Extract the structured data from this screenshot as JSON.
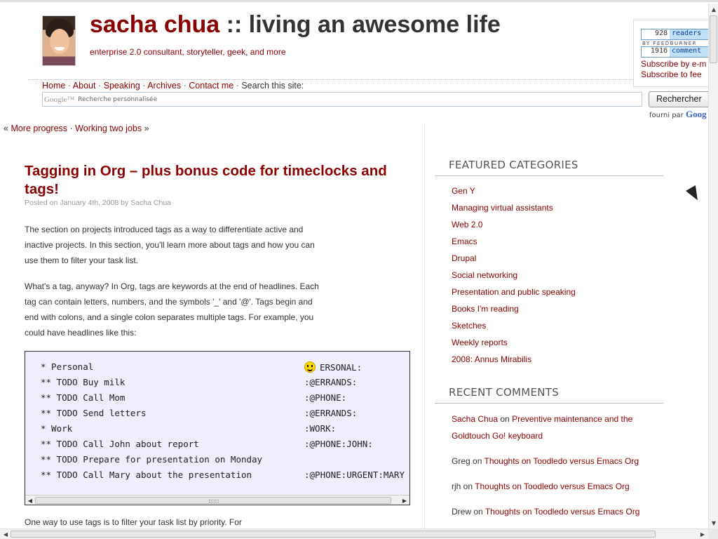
{
  "header": {
    "title_name": "sacha chua",
    "title_rest": " :: living an awesome life",
    "tagline": "enterprise 2.0 consultant, storyteller, geek, and more"
  },
  "feedburner": {
    "readers_count": "928",
    "readers_label": "readers",
    "by_label": "BY FEEDBURNER",
    "comments_count": "1916",
    "comments_label": "comment",
    "subscribe_email": "Subscribe by e-m",
    "subscribe_feed": "Subscribe to fee"
  },
  "nav": {
    "items": [
      "Home",
      "About",
      "Speaking",
      "Archives",
      "Contact me"
    ],
    "search_label": "Search this site:",
    "separator": "·"
  },
  "search": {
    "google_logo": "Google™",
    "placeholder": "Recherche personnalisée",
    "button": "Rechercher",
    "powered_by": "fourni par",
    "powered_logo": "Goog"
  },
  "post_nav": {
    "prev_marker": "«",
    "prev": "More progress",
    "sep": "·",
    "next": "Working two jobs",
    "next_marker": "»"
  },
  "post": {
    "title": "Tagging in Org – plus bonus code for timeclocks and tags!",
    "meta_prefix": "Posted on ",
    "date": "January 4th, 2008",
    "meta_by": " by ",
    "author": "Sacha Chua",
    "para1": "The section on projects introduced tags as a way to differentiate active and inactive projects. In this section, you'll learn more about tags and how you can use them to filter your task list.",
    "para2": "What's a tag, anyway? In Org, tags are keywords at the end of headlines. Each tag can contain letters, numbers, and the symbols '_' and '@'. Tags begin and end with colons, and a single colon separates multiple tags. For example, you could have headlines like this:",
    "para3": "One way to use tags is to filter your task list by priority. For",
    "code": [
      {
        "text": "* Personal",
        "tags": "ERSONAL:"
      },
      {
        "text": "** TODO Buy milk",
        "tags": ":@ERRANDS:"
      },
      {
        "text": "** TODO Call Mom",
        "tags": ":@PHONE:"
      },
      {
        "text": "** TODO Send letters",
        "tags": ":@ERRANDS:"
      },
      {
        "text": "* Work",
        "tags": ":WORK:"
      },
      {
        "text": "** TODO Call John about report",
        "tags": ":@PHONE:JOHN:"
      },
      {
        "text": "** TODO Prepare for presentation on Monday",
        "tags": ""
      },
      {
        "text": "** TODO Call Mary about the presentation",
        "tags": ":@PHONE:URGENT:MARY"
      }
    ]
  },
  "sidebar": {
    "categories_title": "FEATURED CATEGORIES",
    "categories": [
      "Gen Y",
      "Managing virtual assistants",
      "Web 2.0",
      "Emacs",
      "Drupal",
      "Social networking",
      "Presentation and public speaking",
      "Books I'm reading",
      "Sketches",
      "Weekly reports",
      "2008: Annus Mirabilis"
    ],
    "comments_title": "RECENT COMMENTS",
    "comments": [
      {
        "author": "Sacha Chua",
        "on": " on ",
        "post": "Preventive maintenance and the Goldtouch Go! keyboard"
      },
      {
        "author": "Greg",
        "on": " on ",
        "post": "Thoughts on Toodledo versus Emacs Org"
      },
      {
        "author": "rjh",
        "on": " on ",
        "post": "Thoughts on Toodledo versus Emacs Org"
      },
      {
        "author": "Drew",
        "on": " on ",
        "post": "Thoughts on Toodledo versus Emacs Org"
      }
    ]
  },
  "colors": {
    "link": "#8b0000",
    "code_bg": "#eeeefc"
  }
}
